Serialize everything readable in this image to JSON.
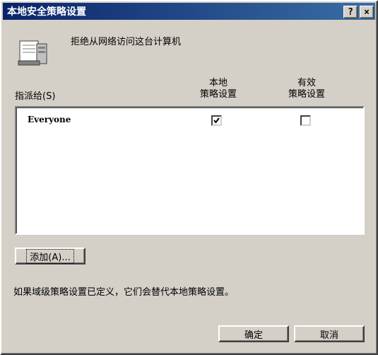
{
  "window": {
    "title": "本地安全策略设置",
    "help_label": "?",
    "close_label": "×"
  },
  "policy": {
    "name": "拒绝从网络访问这台计算机",
    "icon": "policy-server-icon"
  },
  "columns": {
    "assigned_to": "指派给(S)",
    "local_line1": "本地",
    "local_line2": "策略设置",
    "effective_line1": "有效",
    "effective_line2": "策略设置"
  },
  "rows": [
    {
      "name": "Everyone",
      "local_policy": true,
      "effective_policy": false
    }
  ],
  "buttons": {
    "add": "添加(A)...",
    "ok": "确定",
    "cancel": "取消"
  },
  "footnote": "如果域级策略设置已定义，它们会替代本地策略设置。"
}
